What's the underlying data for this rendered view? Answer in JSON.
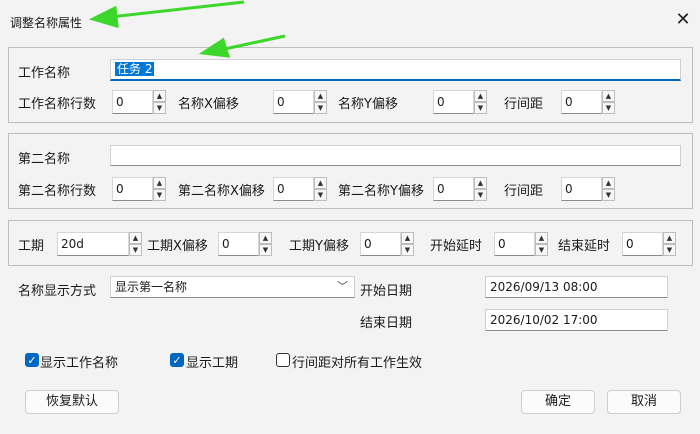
{
  "window": {
    "title": "调整名称属性",
    "close_symbol": "✕"
  },
  "work_name": {
    "label": "工作名称",
    "value": "任务 2",
    "lines_label": "工作名称行数",
    "lines_value": "0",
    "xoffset_label": "名称X偏移",
    "xoffset_value": "0",
    "yoffset_label": "名称Y偏移",
    "yoffset_value": "0",
    "spacing_label": "行间距",
    "spacing_value": "0"
  },
  "second_name": {
    "label": "第二名称",
    "value": "",
    "lines_label": "第二名称行数",
    "lines_value": "0",
    "xoffset_label": "第二名称X偏移",
    "xoffset_value": "0",
    "yoffset_label": "第二名称Y偏移",
    "yoffset_value": "0",
    "spacing_label": "行间距",
    "spacing_value": "0"
  },
  "duration": {
    "label": "工期",
    "value": "20d",
    "xoffset_label": "工期X偏移",
    "xoffset_value": "0",
    "yoffset_label": "工期Y偏移",
    "yoffset_value": "0",
    "start_delay_label": "开始延时",
    "start_delay_value": "0",
    "end_delay_label": "结束延时",
    "end_delay_value": "0"
  },
  "display": {
    "mode_label": "名称显示方式",
    "mode_value": "显示第一名称",
    "start_date_label": "开始日期",
    "start_date_value": "2026/09/13 08:00",
    "end_date_label": "结束日期",
    "end_date_value": "2026/10/02 17:00"
  },
  "options": {
    "show_work_name": {
      "label": "显示工作名称",
      "checked": true
    },
    "show_duration": {
      "label": "显示工期",
      "checked": true
    },
    "spacing_all": {
      "label": "行间距对所有工作生效",
      "checked": false
    }
  },
  "buttons": {
    "reset": "恢复默认",
    "ok": "确定",
    "cancel": "取消"
  },
  "icons": {
    "spin_up": "▲",
    "spin_down": "▼",
    "chevron": "﹀",
    "check": "✓"
  },
  "colors": {
    "accent": "#0067c0",
    "selection": "#0078d7",
    "annotation_arrow": "#3dd62a"
  }
}
